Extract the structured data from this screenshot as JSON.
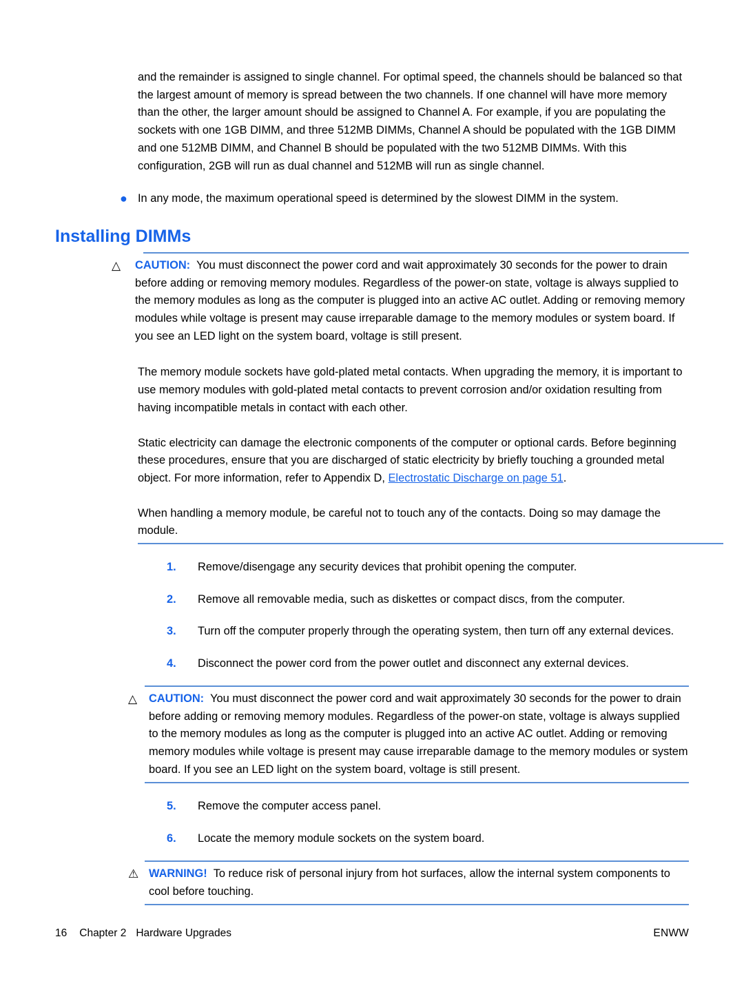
{
  "document": {
    "intro_paragraph": "and the remainder is assigned to single channel. For optimal speed, the channels should be balanced so that the largest amount of memory is spread between the two channels. If one channel will have more memory than the other, the larger amount should be assigned to Channel A. For example, if you are populating the sockets with one 1GB DIMM, and three 512MB DIMMs, Channel A should be populated with the 1GB DIMM and one 512MB DIMM, and Channel B should be populated with the two 512MB DIMMs. With this configuration, 2GB will run as dual channel and 512MB will run as single channel.",
    "bullet": {
      "marker": "●",
      "text": "In any mode, the maximum operational speed is determined by the slowest DIMM in the system."
    },
    "heading": "Installing DIMMs",
    "caution_1": {
      "icon": "△",
      "icon_name": "caution-triangle-icon",
      "label": "CAUTION:",
      "text": "You must disconnect the power cord and wait approximately 30 seconds for the power to drain before adding or removing memory modules. Regardless of the power-on state, voltage is always supplied to the memory modules as long as the computer is plugged into an active AC outlet. Adding or removing memory modules while voltage is present may cause irreparable damage to the memory modules or system board. If you see an LED light on the system board, voltage is still present."
    },
    "paragraph_2": "The memory module sockets have gold-plated metal contacts. When upgrading the memory, it is important to use memory modules with gold-plated metal contacts to prevent corrosion and/or oxidation resulting from having incompatible metals in contact with each other.",
    "paragraph_3": {
      "before_link": "Static electricity can damage the electronic components of the computer or optional cards. Before beginning these procedures, ensure that you are discharged of static electricity by briefly touching a grounded metal object. For more information, refer to Appendix D, ",
      "link_text": "Electrostatic Discharge on page 51",
      "after_link": "."
    },
    "paragraph_4": "When handling a memory module, be careful not to touch any of the contacts. Doing so may damage the module.",
    "steps": [
      {
        "number": "1.",
        "text": "Remove/disengage any security devices that prohibit opening the computer."
      },
      {
        "number": "2.",
        "text": "Remove all removable media, such as diskettes or compact discs, from the computer."
      },
      {
        "number": "3.",
        "text": "Turn off the computer properly through the operating system, then turn off any external devices."
      },
      {
        "number": "4.",
        "text": "Disconnect the power cord from the power outlet and disconnect any external devices."
      },
      {
        "number": "5.",
        "text": "Remove the computer access panel."
      },
      {
        "number": "6.",
        "text": "Locate the memory module sockets on the system board."
      }
    ],
    "caution_2": {
      "icon": "△",
      "icon_name": "caution-triangle-icon",
      "label": "CAUTION:",
      "text": "You must disconnect the power cord and wait approximately 30 seconds for the power to drain before adding or removing memory modules. Regardless of the power-on state, voltage is always supplied to the memory modules as long as the computer is plugged into an active AC outlet. Adding or removing memory modules while voltage is present may cause irreparable damage to the memory modules or system board. If you see an LED light on the system board, voltage is still present."
    },
    "warning": {
      "icon": "⚠",
      "icon_name": "warning-triangle-icon",
      "label": "WARNING!",
      "text": "To reduce risk of personal injury from hot surfaces, allow the internal system components to cool before touching."
    },
    "footer": {
      "page_number": "16",
      "chapter": "Chapter 2",
      "chapter_title": "Hardware Upgrades",
      "right": "ENWW"
    },
    "colors": {
      "accent_blue": "#1763E8",
      "rule_blue": "#5B8FD6",
      "text_black": "#000000"
    }
  }
}
